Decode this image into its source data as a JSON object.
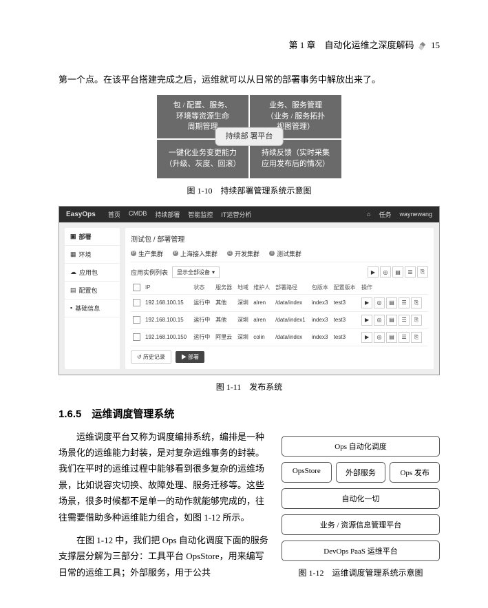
{
  "header": {
    "chapter": "第 1 章　自动化运维之深度解码",
    "page_number": "15"
  },
  "intro_text": "第一个点。在该平台搭建完成之后，运维就可以从日常的部署事务中解放出来了。",
  "fig110": {
    "cells": [
      "包 / 配置、服务、\n环境等资源生命\n周期管理",
      "业务、服务管理\n（业务 / 服务拓扑\n视图管理）",
      "一键化业务变更能力\n（升级、灰度、回滚）",
      "持续反馈（实时采集\n应用发布后的情况）"
    ],
    "center": "持续部\n署平台",
    "caption": "图 1-10　持续部署管理系统示意图"
  },
  "screenshot": {
    "brand": "EasyOps",
    "nav": [
      "首页",
      "CMDB",
      "持续部署",
      "智能监控",
      "IT运营分析"
    ],
    "nav_right": {
      "home_icon": "⌂",
      "task_label": "任务",
      "user": "waynewang"
    },
    "sidebar": [
      {
        "icon": "▣",
        "label": "部署",
        "active": true
      },
      {
        "icon": "▦",
        "label": "环境"
      },
      {
        "icon": "☁",
        "label": "应用包"
      },
      {
        "icon": "▤",
        "label": "配置包"
      },
      {
        "icon": "▪",
        "label": "基础信息"
      }
    ],
    "breadcrumb": "测试包 / 部署管理",
    "tabs": [
      {
        "badge": "P",
        "label": "生产集群"
      },
      {
        "badge": "P",
        "label": "上海接入集群"
      },
      {
        "badge": "D",
        "label": "开发集群"
      },
      {
        "badge": "T",
        "label": "测试集群"
      }
    ],
    "filter": {
      "left_label": "应用实例列表",
      "select": "显示全部设备",
      "caret": "▾"
    },
    "action_icons": [
      "▶",
      "◎",
      "▤",
      "☰",
      "⎘"
    ],
    "columns": [
      "",
      "IP",
      "状态",
      "服务器",
      "地域",
      "维护人",
      "部署路径",
      "包版本",
      "配置版本",
      "操作"
    ],
    "rows": [
      {
        "ip": "192.168.100.15",
        "status": "运行中",
        "host": "其他",
        "region": "深圳",
        "owner": "alren",
        "path": "/data/index",
        "pkg": "index3",
        "cfg": "test3"
      },
      {
        "ip": "192.168.100.15",
        "status": "运行中",
        "host": "其他",
        "region": "深圳",
        "owner": "alren",
        "path": "/data/index1",
        "pkg": "index3",
        "cfg": "test3"
      },
      {
        "ip": "192.168.100.150",
        "status": "运行中",
        "host": "阿里云",
        "region": "深圳",
        "owner": "colin",
        "path": "/data/index",
        "pkg": "index3",
        "cfg": "test3"
      }
    ],
    "row_action_icons": [
      "▶",
      "◎",
      "▤",
      "☰",
      "⎘"
    ],
    "footer": {
      "history": "历史记录",
      "deploy": "▶ 部署"
    }
  },
  "fig111_caption": "图 1-11　发布系统",
  "section_165": {
    "heading": "1.6.5　运维调度管理系统",
    "para1": "运维调度平台又称为调度编排系统，编排是一种场景化的运维能力封装，是对复杂运维事务的封装。我们在平时的运维过程中能够看到很多复杂的运维场景，比如说容灾切换、故障处理、服务迁移等。这些场景，很多时候都不是单一的动作就能够完成的，往往需要借助多种运维能力组合，如图 1-12 所示。",
    "para2": "在图 1-12 中，我们把 Ops 自动化调度下面的服务支撑层分解为三部分：工具平台 OpsStore，用来编写日常的运维工具；外部服务，用于公共"
  },
  "fig112": {
    "boxes": {
      "top": "Ops 自动化调度",
      "row": [
        "OpsStore",
        "外部服务",
        "Ops 发布"
      ],
      "mid1": "自动化一切",
      "mid2": "业务 / 资源信息管理平台",
      "bottom": "DevOps PaaS 运维平台"
    },
    "caption": "图 1-12　运维调度管理系统示意图"
  }
}
